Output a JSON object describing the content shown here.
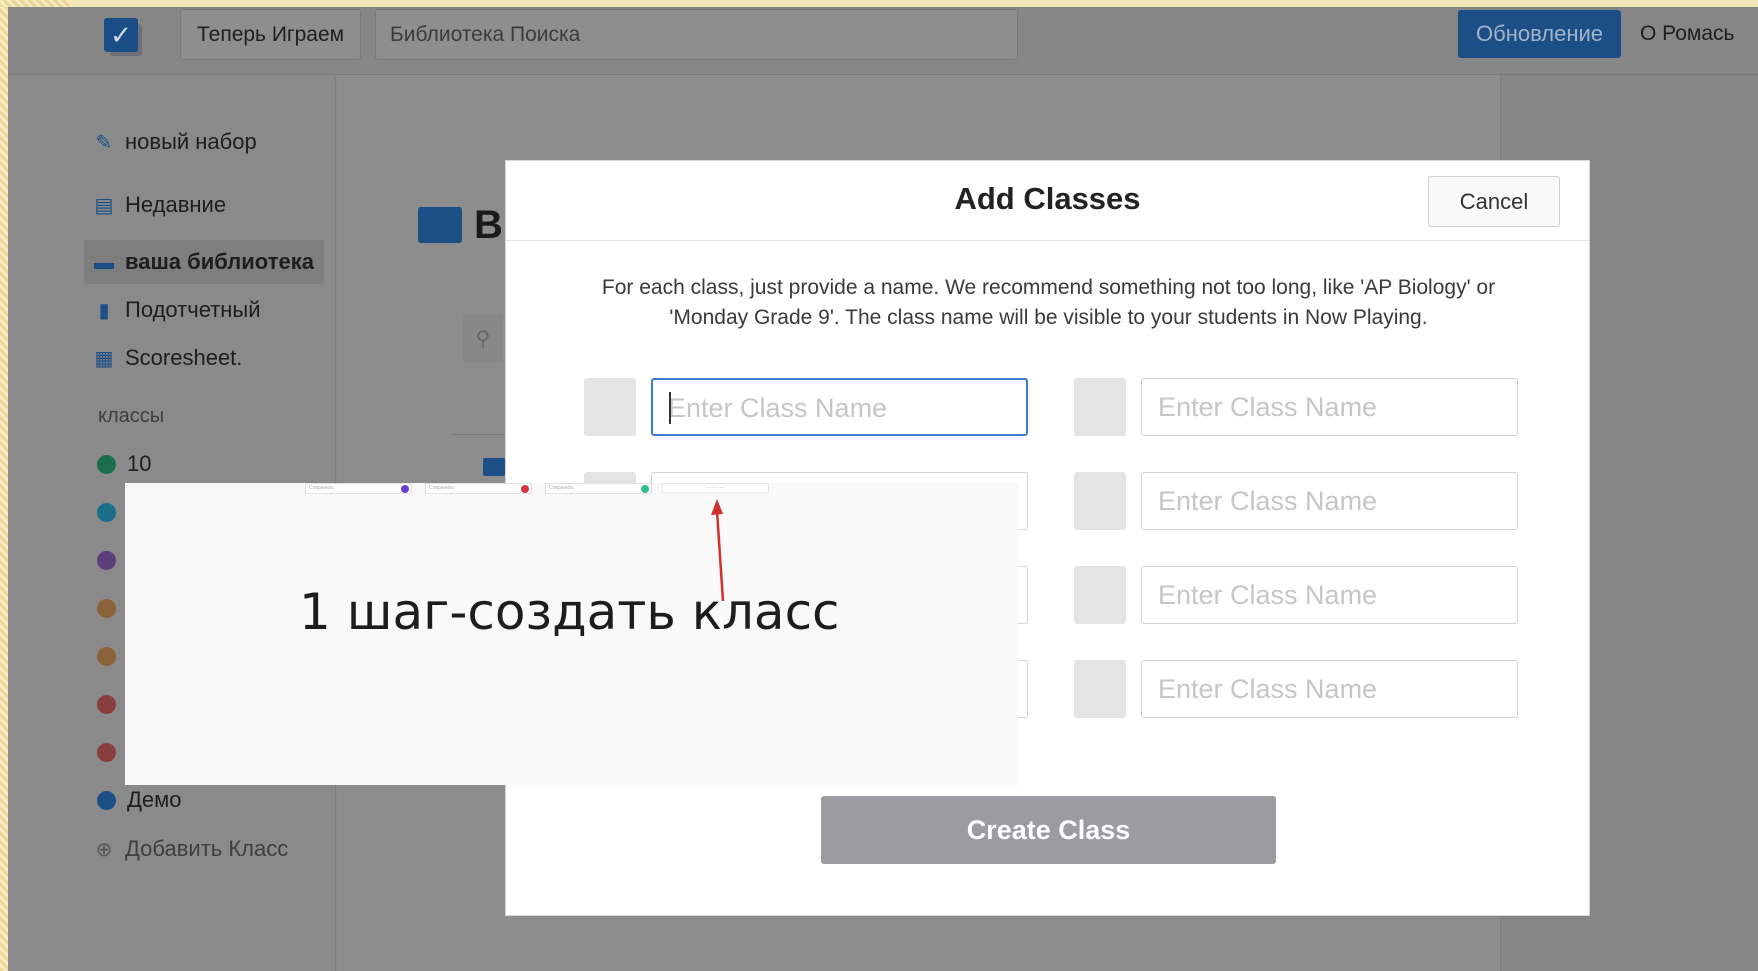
{
  "topbar": {
    "now_playing_label": "Теперь Играем",
    "search_placeholder": "Библиотека Поиска",
    "update_label": "Обновление",
    "about_label": "О Ромась"
  },
  "sidebar": {
    "new_set": "новый набор",
    "recent": "Недавние",
    "your_library": "ваша библиотека",
    "reports": "Подотчетный",
    "scoresheet": "Scoresheet.",
    "classes_heading": "классы",
    "classes": [
      {
        "label": "10",
        "color": "#1a6e49"
      },
      {
        "label": "",
        "color": "#1a6e8a"
      },
      {
        "label": "",
        "color": "#5a3f7a"
      },
      {
        "label": "",
        "color": "#8a6238"
      },
      {
        "label": "",
        "color": "#8a6238"
      },
      {
        "label": "",
        "color": "#8a3d3d"
      },
      {
        "label": "",
        "color": "#8a3d3d"
      },
      {
        "label": "Демо",
        "color": "#1c4f85"
      }
    ],
    "add_class": "Добавить Класс"
  },
  "main": {
    "title_initial": "B"
  },
  "modal": {
    "title": "Add Classes",
    "cancel_label": "Cancel",
    "description": "For each class, just provide a name. We recommend something not too long, like 'AP Biology' or 'Monday Grade 9'. The class name will be visible to your students in Now Playing.",
    "input_placeholder": "Enter Class Name",
    "create_label": "Create Class"
  },
  "annotation": {
    "text": "1 шаг-создать класс",
    "mini_labels": [
      "Сохранить",
      "Сохранить",
      "Сохранить"
    ],
    "mini_input_label": "····· ·····",
    "mini_dot_colors": [
      "#6b3fd6",
      "#d6333a",
      "#2bbf8a"
    ],
    "arrow_color": "#d0312d"
  }
}
